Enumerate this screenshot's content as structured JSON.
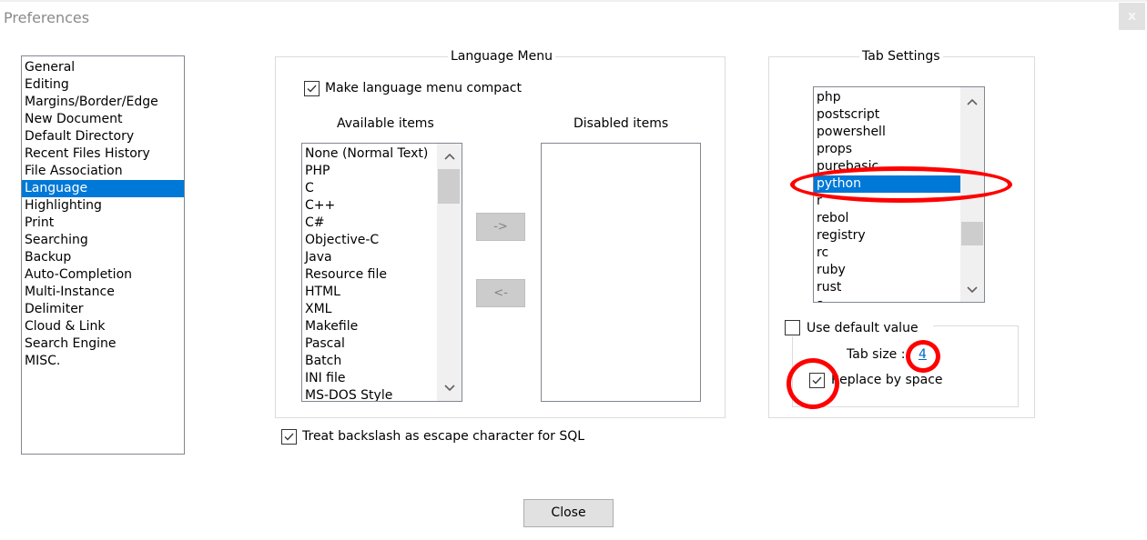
{
  "window": {
    "title": "Preferences",
    "close_glyph": "x"
  },
  "sidebar": {
    "selected_index": 7,
    "items": [
      {
        "label": "General"
      },
      {
        "label": "Editing"
      },
      {
        "label": "Margins/Border/Edge"
      },
      {
        "label": "New Document"
      },
      {
        "label": "Default Directory"
      },
      {
        "label": "Recent Files History"
      },
      {
        "label": "File Association"
      },
      {
        "label": "Language"
      },
      {
        "label": "Highlighting"
      },
      {
        "label": "Print"
      },
      {
        "label": "Searching"
      },
      {
        "label": "Backup"
      },
      {
        "label": "Auto-Completion"
      },
      {
        "label": "Multi-Instance"
      },
      {
        "label": "Delimiter"
      },
      {
        "label": "Cloud & Link"
      },
      {
        "label": "Search Engine"
      },
      {
        "label": "MISC."
      }
    ]
  },
  "language_menu": {
    "legend": "Language Menu",
    "compact_checkbox": {
      "label": "Make language menu compact",
      "checked": true
    },
    "available_header": "Available items",
    "disabled_header": "Disabled items",
    "available_items": [
      "None (Normal Text)",
      "PHP",
      "C",
      "C++",
      "C#",
      "Objective-C",
      "Java",
      "Resource file",
      "HTML",
      "XML",
      "Makefile",
      "Pascal",
      "Batch",
      "INI file",
      "MS-DOS Style"
    ],
    "disabled_items": [],
    "move_right_label": "->",
    "move_left_label": "<-"
  },
  "sql_checkbox": {
    "label": "Treat backslash as escape character for SQL",
    "checked": true
  },
  "tab_settings": {
    "legend": "Tab Settings",
    "languages": [
      "php",
      "postscript",
      "powershell",
      "props",
      "purebasic",
      "python",
      "r",
      "rebol",
      "registry",
      "rc",
      "ruby",
      "rust",
      "s"
    ],
    "selected_language": "python",
    "use_default_checkbox": {
      "label": "Use default value",
      "checked": false
    },
    "tab_size_label": "Tab size :",
    "tab_size_value": "4",
    "replace_space_checkbox": {
      "label": "Replace by space",
      "checked": true
    }
  },
  "footer": {
    "close_label": "Close"
  },
  "annotations": {
    "color": "#ff0000"
  }
}
